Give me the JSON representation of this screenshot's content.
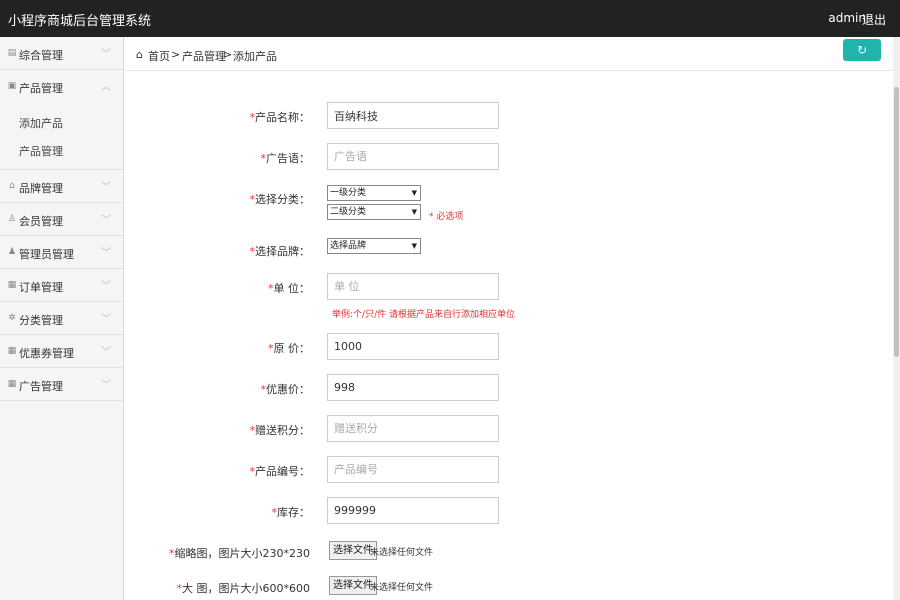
{
  "topbar": {
    "title": "小程序商城后台管理系统",
    "user": "admin",
    "logout": "退出"
  },
  "sidebar": {
    "items": [
      {
        "label": "综合管理",
        "icon": "doc-icon"
      },
      {
        "label": "产品管理",
        "icon": "box-icon",
        "expanded": true,
        "children": [
          {
            "label": "添加产品"
          },
          {
            "label": "产品管理"
          }
        ]
      },
      {
        "label": "品牌管理",
        "icon": "bag-icon"
      },
      {
        "label": "会员管理",
        "icon": "user-icon"
      },
      {
        "label": "管理员管理",
        "icon": "admin-icon"
      },
      {
        "label": "订单管理",
        "icon": "list-icon"
      },
      {
        "label": "分类管理",
        "icon": "gear-icon"
      },
      {
        "label": "优惠券管理",
        "icon": "coupon-icon"
      },
      {
        "label": "广告管理",
        "icon": "ad-icon"
      }
    ]
  },
  "breadcrumb": {
    "home": "首页",
    "sep": ">",
    "section": "产品管理",
    "page": "添加产品"
  },
  "form": {
    "name": {
      "label": "产品名称：",
      "value": "百纳科技"
    },
    "slogan": {
      "label": "广告语：",
      "placeholder": "广告语"
    },
    "category": {
      "label": "选择分类：",
      "level1": "一级分类",
      "level2": "二级分类",
      "hint": "* 必选项"
    },
    "brand": {
      "label": "选择品牌：",
      "value": "选择品牌"
    },
    "unit": {
      "label": "单 位：",
      "placeholder": "单 位",
      "hint": "举例:个/只/件  请根据产品来自行添加相应单位"
    },
    "price": {
      "label": "原 价：",
      "value": "1000"
    },
    "sale": {
      "label": "优惠价：",
      "value": "998"
    },
    "points": {
      "label": "赠送积分：",
      "placeholder": "赠送积分"
    },
    "sku": {
      "label": "产品编号：",
      "placeholder": "产品编号"
    },
    "stock": {
      "label": "库存：",
      "value": "999999"
    },
    "thumb": {
      "label": "缩略图，图片大小230*230",
      "button": "选择文件",
      "status": "未选择任何文件"
    },
    "large": {
      "label": "大 图，图片大小600*600",
      "button": "选择文件",
      "status": "未选择任何文件"
    }
  },
  "required_mark": "*",
  "colors": {
    "topbar": "#222222",
    "accent": "#1fb5ad",
    "required": "#e33333"
  }
}
